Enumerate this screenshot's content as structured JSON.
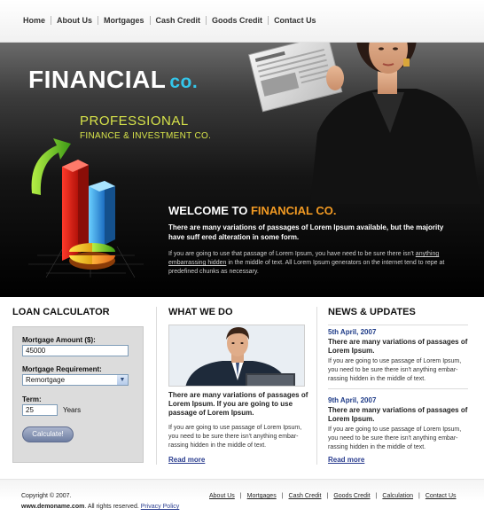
{
  "nav": {
    "items": [
      "Home",
      "About Us",
      "Mortgages",
      "Cash Credit",
      "Goods Credit",
      "Contact Us"
    ]
  },
  "hero": {
    "logo_main": "FINANCIAL",
    "logo_co": "co.",
    "tagline_1": "PROFESSIONAL",
    "tagline_2": "FINANCE & INVESTMENT CO.",
    "welcome_prefix": "WELCOME TO ",
    "welcome_highlight": "FINANCIAL CO.",
    "lead": "There are many variations of passages of Lorem Ipsum available, but the majority have suff ered alteration in some form.",
    "body_1": "If you are going to use that passage of Lorem Ipsum, you have need to be sure there isn't ",
    "body_link": "anything embarrassing hidden",
    "body_2": " in the middle of text.  All Lorem Ipsum generators on the  internet tend to repe at predefined chunks as necessary."
  },
  "loan": {
    "title": "LOAN CALCULATOR",
    "amount_label": "Mortgage Amount ($):",
    "amount_value": "45000",
    "requirement_label": "Mortgage Requirement:",
    "requirement_value": "Remortgage",
    "term_label": "Term:",
    "term_value": "25",
    "term_unit": "Years",
    "button": "Calculate!"
  },
  "what": {
    "title": "WHAT WE DO",
    "lead": "There are many variations of passages of Lorem Ipsum. If you are going to use passage of Lorem Ipsum.",
    "body": "If you are going to use passage of Lorem Ipsum, you need to be sure there isn't anything embar-rassing hidden in the middle of text.",
    "read_more": "Read more"
  },
  "news": {
    "title": "NEWS & UPDATES",
    "items": [
      {
        "date": "5th April, 2007",
        "title": "There are many variations of passages of Lorem Ipsum.",
        "body": "If you are going to use passage of Lorem Ipsum, you need to be sure there isn't anything embar-rassing hidden in the middle of text."
      },
      {
        "date": "9th April, 2007",
        "title": "There are many variations of passages of Lorem Ipsum.",
        "body": "If you are going to use passage of Lorem Ipsum, you need to be sure there isn't anything embar-rassing hidden in the middle of text."
      }
    ],
    "read_more": "Read more"
  },
  "footer": {
    "copyright": "Copyright © 2007.",
    "domain": "www.demoname.com",
    "rights": ". All rights reserved.",
    "privacy": "Privacy Policy",
    "links": [
      "About Us",
      "Mortgages",
      "Cash Credit",
      "Goods Credit",
      "Calculation",
      "Contact Us"
    ],
    "separator": "|"
  },
  "colors": {
    "logo_accent": "#34c6ea",
    "tagline": "#d7e34a",
    "welcome_accent": "#f29a23",
    "link_blue": "#2a3d8f",
    "news_date": "#1f3c88"
  },
  "icons": {
    "hero_chart": "3d-bar-chart-with-green-arrow-illustration",
    "hero_person": "woman-reading-newspaper-photo",
    "what_photo": "businessman-at-laptop-photo",
    "select_arrow": "chevron-down-icon"
  }
}
